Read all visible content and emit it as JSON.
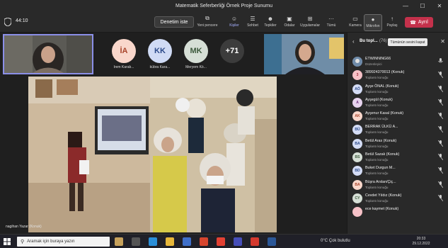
{
  "window": {
    "title": "Matematik Seferberliği Örnek Proje Sunumu",
    "controls": [
      "—",
      "☐",
      "✕"
    ]
  },
  "toolbar": {
    "timer": "44:10",
    "denetim_label": "Denetim iste",
    "buttons": [
      {
        "icon": "new-window-icon",
        "glyph": "⧉",
        "label": "Yeni pencere"
      },
      {
        "icon": "people-icon",
        "glyph": "☺",
        "label": "Kişiler"
      },
      {
        "icon": "chat-icon",
        "glyph": "☰",
        "label": "Sohbet"
      },
      {
        "icon": "reactions-icon",
        "glyph": "☻",
        "label": "Tepkiler"
      },
      {
        "icon": "rooms-icon",
        "glyph": "▣",
        "label": "Odalar"
      },
      {
        "icon": "apps-icon",
        "glyph": "⊞",
        "label": "Uygulamalar"
      },
      {
        "icon": "more-icon",
        "glyph": "···",
        "label": "Tümü"
      },
      {
        "icon": "camera-icon",
        "glyph": "▭",
        "label": "Kamera"
      },
      {
        "icon": "microphone-icon",
        "glyph": "●",
        "label": "Mikrofon"
      },
      {
        "icon": "share-icon",
        "glyph": "↑",
        "label": "Paylaş"
      }
    ],
    "leave_label": "Ayrıl"
  },
  "top_row": {
    "avatars": [
      {
        "initials": "İA",
        "name": "İrem Karab...",
        "bg": "#f9d7cb",
        "fg": "#a8442a"
      },
      {
        "initials": "KK",
        "name": "kübra Kara...",
        "bg": "#d0dbf5",
        "fg": "#2c4a8a"
      },
      {
        "initials": "MK",
        "name": "Meryem Kö...",
        "bg": "#d6dfd6",
        "fg": "#3d5a3d"
      },
      {
        "initials": "+71",
        "name": "",
        "bg": "#3c3c3c",
        "fg": "#ffffff"
      }
    ]
  },
  "stage": {
    "presenter_name": "nagihan Yazar (Konuk)"
  },
  "panel": {
    "title": "Bu topl...",
    "count": "(76)",
    "mute_all_label": "Tümünün sesini kapat",
    "participants": [
      {
        "initials": "",
        "name": "ETWINNING66",
        "role": "Düzenleyici",
        "bg": "#7a7a7a",
        "fg": "#fff"
      },
      {
        "initials": "3",
        "name": "389924370013 (Konuk)",
        "role": "Toplantı konuğu",
        "bg": "#f6c1c7",
        "fg": "#9c2a3a"
      },
      {
        "initials": "AÖ",
        "name": "Ayşe ÖNAL (Konuk)",
        "role": "Toplantı konuğu",
        "bg": "#d4dcf5",
        "fg": "#2c4a8a"
      },
      {
        "initials": "A",
        "name": "Ayşegül (Konuk)",
        "role": "Toplantı konuğu",
        "bg": "#e7d3ee",
        "fg": "#6b2f7a"
      },
      {
        "initials": "AK",
        "name": "Ayşenur Kasal (Konuk)",
        "role": "Toplantı konuğu",
        "bg": "#f9d7cb",
        "fg": "#a8442a"
      },
      {
        "initials": "BÜ",
        "name": "BERRAK ÜLKÜ A...",
        "role": "Toplantı konuğu",
        "bg": "#d4dcf5",
        "fg": "#2c4a8a"
      },
      {
        "initials": "BA",
        "name": "Betül Aras (Konuk)",
        "role": "Toplantı konuğu",
        "bg": "#d4dcf5",
        "fg": "#2c4a8a"
      },
      {
        "initials": "BS",
        "name": "Betül Sazak (Konuk)",
        "role": "Toplantı konuğu",
        "bg": "#d6dfd6",
        "fg": "#3d5a3d"
      },
      {
        "initials": "BD",
        "name": "Buket Durgun M...",
        "role": "Toplantı konuğu",
        "bg": "#d4dcf5",
        "fg": "#2c4a8a"
      },
      {
        "initials": "BA",
        "name": "Büşra Arslan/Çiç...",
        "role": "Toplantı konuğu",
        "bg": "#f9d7cb",
        "fg": "#a8442a"
      },
      {
        "initials": "CY",
        "name": "Cevdet Yıldız (Konuk)",
        "role": "Toplantı konuğu",
        "bg": "#d6dfd6",
        "fg": "#3d5a3d"
      },
      {
        "initials": "",
        "name": "ece kaymet (Konuk)",
        "role": "",
        "bg": "#f6c1c7",
        "fg": "#9c2a3a"
      }
    ]
  },
  "taskbar": {
    "search_placeholder": "Aramak için buraya yazın",
    "weather": "0°C  Çok bulutlu",
    "time": "20:33",
    "date": "29.12.2022"
  }
}
